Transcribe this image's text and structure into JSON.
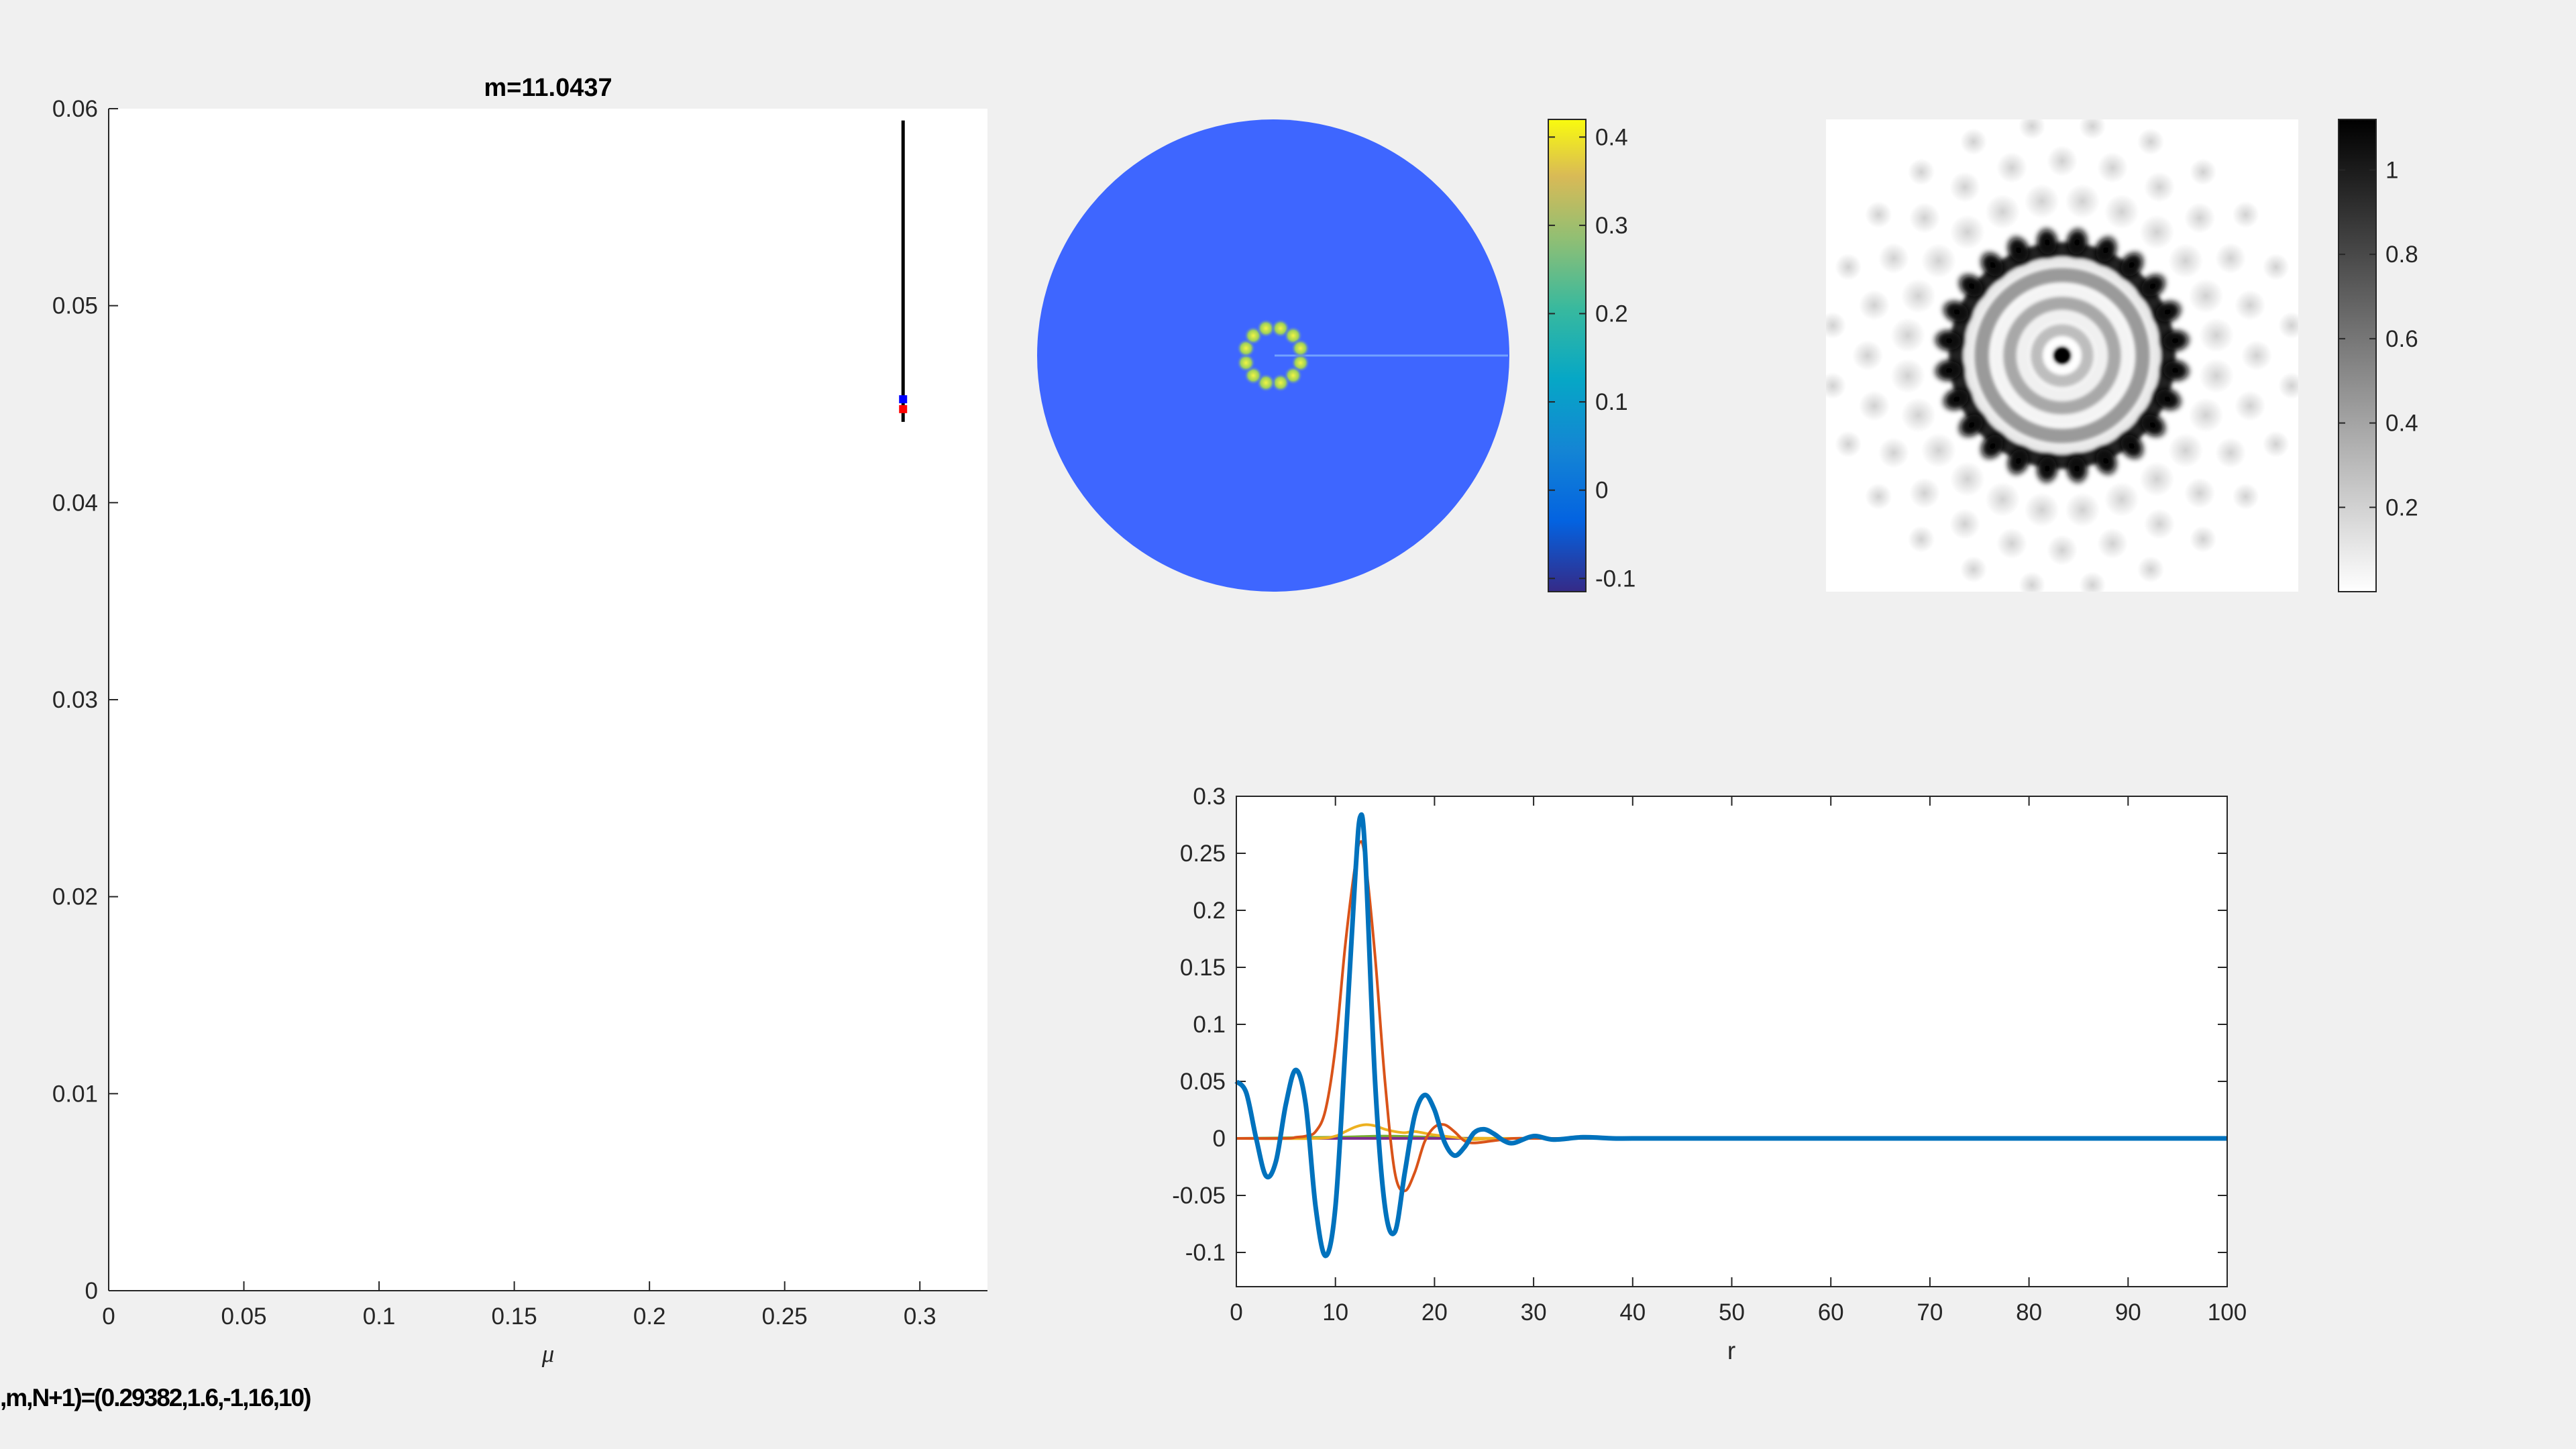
{
  "footer_text": ",m,N+1)=(0.29382,1.6,-1,16,10)",
  "chart_data": [
    {
      "type": "line",
      "title": "m=11.0437",
      "xlabel": "μ",
      "ylabel": "",
      "xlim": [
        0,
        0.325
      ],
      "ylim": [
        0,
        0.06
      ],
      "xticks": [
        "0",
        "0.05",
        "0.1",
        "0.15",
        "0.2",
        "0.25",
        "0.3"
      ],
      "yticks": [
        "0",
        "0.01",
        "0.02",
        "0.03",
        "0.04",
        "0.05",
        "0.06"
      ],
      "series": [
        {
          "x": [
            0.2938,
            0.2938
          ],
          "y": [
            0.0441,
            0.0594
          ],
          "color": "#000000"
        }
      ],
      "markers": [
        {
          "x": 0.2938,
          "y": 0.04475,
          "color": "#ff0000"
        },
        {
          "x": 0.2938,
          "y": 0.04525,
          "color": "#0000ff"
        }
      ]
    },
    {
      "type": "heatmap",
      "colormap": "parula",
      "colorbar_ticks": [
        "-0.1",
        "0",
        "0.1",
        "0.2",
        "0.3",
        "0.4"
      ],
      "clim": [
        -0.115,
        0.42
      ],
      "background_color": "#3e66ff",
      "ring_spots": 12,
      "spot_color": "#c8e63a"
    },
    {
      "type": "heatmap",
      "colormap": "gray_reversed",
      "colorbar_ticks": [
        "0.2",
        "0.4",
        "0.6",
        "0.8",
        "1"
      ],
      "clim": [
        0,
        1.12
      ],
      "outer_ring_spots": 24
    },
    {
      "type": "line",
      "xlabel": "r",
      "ylabel": "",
      "xlim": [
        0,
        100
      ],
      "ylim": [
        -0.13,
        0.3
      ],
      "xticks": [
        "0",
        "10",
        "20",
        "30",
        "40",
        "50",
        "60",
        "70",
        "80",
        "90",
        "100"
      ],
      "yticks": [
        "-0.1",
        "-0.05",
        "0",
        "0.05",
        "0.1",
        "0.15",
        "0.2",
        "0.25",
        "0.3"
      ],
      "series": [
        {
          "color": "#0072bd",
          "x": [
            0,
            1,
            2,
            3,
            4,
            5,
            6,
            7,
            8,
            9,
            10,
            11,
            12,
            12.5,
            13,
            14,
            15,
            16,
            17,
            18,
            19,
            20,
            21,
            22,
            23,
            24,
            25,
            26,
            27,
            28,
            30,
            32,
            35,
            38,
            40,
            45,
            50,
            100
          ],
          "y": [
            0.05,
            0.04,
            0.0,
            -0.033,
            -0.02,
            0.03,
            0.06,
            0.03,
            -0.06,
            -0.103,
            -0.06,
            0.08,
            0.23,
            0.282,
            0.25,
            0.05,
            -0.06,
            -0.082,
            -0.03,
            0.02,
            0.038,
            0.025,
            -0.003,
            -0.015,
            -0.008,
            0.005,
            0.008,
            0.004,
            -0.002,
            -0.004,
            0.002,
            -0.001,
            0.001,
            0.0,
            0.0,
            0.0,
            0.0,
            0.0
          ]
        },
        {
          "color": "#d95319",
          "x": [
            0,
            5,
            6,
            7,
            8,
            9,
            10,
            11,
            12,
            12.5,
            13,
            14,
            15,
            16,
            17,
            18,
            19,
            20,
            21,
            22,
            23,
            24,
            26,
            28,
            30,
            35,
            100
          ],
          "y": [
            0,
            0,
            0.001,
            0.002,
            0.006,
            0.025,
            0.08,
            0.17,
            0.24,
            0.26,
            0.245,
            0.16,
            0.05,
            -0.03,
            -0.046,
            -0.03,
            -0.003,
            0.01,
            0.012,
            0.006,
            -0.002,
            -0.004,
            -0.002,
            0.0,
            0.0,
            0.0,
            0.0
          ]
        },
        {
          "color": "#edb120",
          "x": [
            0,
            8,
            10,
            11,
            12,
            13,
            14,
            15,
            16,
            17,
            18,
            20,
            22,
            24,
            26,
            30,
            100
          ],
          "y": [
            0,
            0,
            0.002,
            0.006,
            0.01,
            0.012,
            0.011,
            0.008,
            0.006,
            0.005,
            0.006,
            0.003,
            0.001,
            -0.001,
            0.0,
            0.0,
            0.0
          ]
        },
        {
          "color": "#7e2f8e",
          "x": [
            0,
            100
          ],
          "y": [
            0,
            0
          ]
        },
        {
          "color": "#77ac30",
          "x": [
            0,
            10,
            15,
            20,
            30,
            100
          ],
          "y": [
            0,
            0.001,
            0.002,
            0.001,
            0.0,
            0.0
          ]
        }
      ]
    }
  ]
}
